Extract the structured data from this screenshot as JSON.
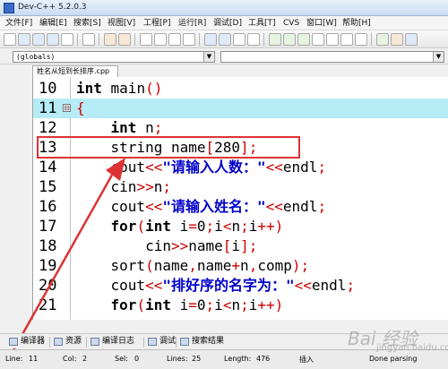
{
  "window": {
    "title": "Dev-C++ 5.2.0.3"
  },
  "menu": [
    "文件[F]",
    "编辑[E]",
    "搜索[S]",
    "视图[V]",
    "工程[P]",
    "运行[R]",
    "调试[D]",
    "工具[T]",
    "CVS",
    "窗口[W]",
    "帮助[H]"
  ],
  "scope": {
    "selected": "(globals)"
  },
  "tab": {
    "label": "姓名从短到长排序.cpp"
  },
  "editor": {
    "lines": [
      {
        "num": "10",
        "code": "int main()"
      },
      {
        "num": "11",
        "code": "{"
      },
      {
        "num": "12",
        "code": "    int n;"
      },
      {
        "num": "13",
        "code": "    string name[280];"
      },
      {
        "num": "14",
        "code": "    cout<<\"请输入人数：\"<<endl;"
      },
      {
        "num": "15",
        "code": "    cin>>n;"
      },
      {
        "num": "16",
        "code": "    cout<<\"请输入姓名：\"<<endl;"
      },
      {
        "num": "17",
        "code": "    for(int i=0;i<n;i++)"
      },
      {
        "num": "18",
        "code": "        cin>>name[i];"
      },
      {
        "num": "19",
        "code": "    sort(name,name+n,comp);"
      },
      {
        "num": "20",
        "code": "    cout<<\"排好序的名字为：\"<<endl;"
      },
      {
        "num": "21",
        "code": "    for(int i=0;i<n;i++)"
      }
    ]
  },
  "bottom_tabs": [
    "编译器",
    "资源",
    "编译日志",
    "调试",
    "搜索结果"
  ],
  "status": {
    "line_label": "Line:",
    "line": "11",
    "col_label": "Col:",
    "col": "2",
    "sel_label": "Sel:",
    "sel": "0",
    "lines_label": "Lines:",
    "lines": "25",
    "length_label": "Length:",
    "length": "476",
    "mode": "插入",
    "state": "Done parsing"
  },
  "watermark": {
    "brand": "Bai 经验",
    "url": "jingyan.baidu.com"
  },
  "colors": {
    "highlight_line": "#b6ecf5",
    "annotation": "#dd3333",
    "keyword": "#000000",
    "operator": "#cc0000",
    "string": "#0000cc"
  }
}
